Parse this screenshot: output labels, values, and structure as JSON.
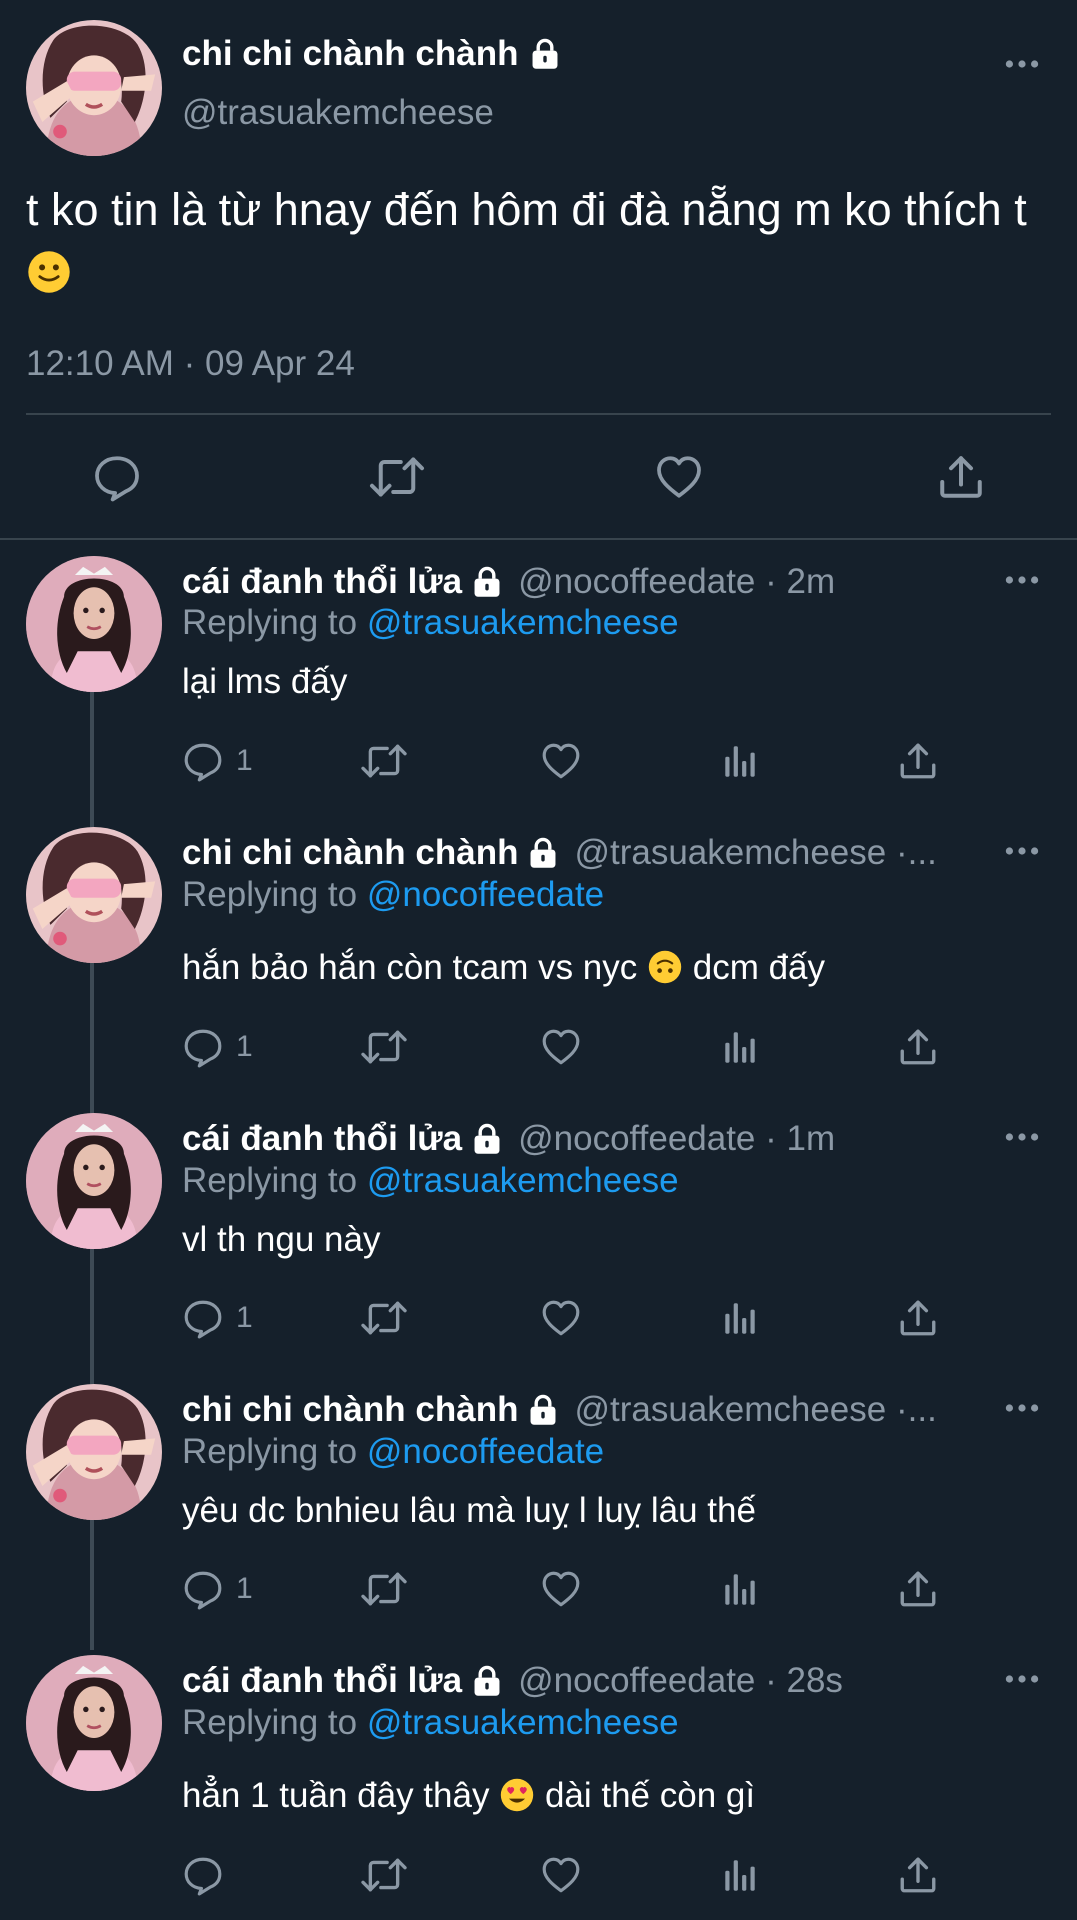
{
  "main_tweet": {
    "display_name": "chi chi chành chành",
    "handle": "@trasuakemcheese",
    "text": "t ko tin là từ hnay đến hôm đi đà nẵng m ko thích t",
    "timestamp": "12:10 AM · 09 Apr 24",
    "actions": [
      "reply-icon",
      "retweet-icon",
      "like-icon",
      "share-icon"
    ]
  },
  "replies": [
    {
      "display_name": "cái đanh thổi lửa",
      "handle_meta": "@nocoffeedate · 2m",
      "replying_label": "Replying to",
      "replying_to": "@trasuakemcheese",
      "text": "lại lms đấy",
      "reply_count": "1",
      "avatar": "girl"
    },
    {
      "display_name": "chi chi chành chành",
      "handle_meta": "@trasuakemcheese ·...",
      "replying_label": "Replying to",
      "replying_to": "@nocoffeedate",
      "text_before": "hắn bảo hắn còn tcam vs nyc",
      "text_after": "dcm đấy",
      "reply_count": "1",
      "avatar": "cartoon"
    },
    {
      "display_name": "cái đanh thổi lửa",
      "handle_meta": "@nocoffeedate · 1m",
      "replying_label": "Replying to",
      "replying_to": "@trasuakemcheese",
      "text": "vl th ngu này",
      "reply_count": "1",
      "avatar": "girl"
    },
    {
      "display_name": "chi chi chành chành",
      "handle_meta": "@trasuakemcheese ·...",
      "replying_label": "Replying to",
      "replying_to": "@nocoffeedate",
      "text": "yêu dc bnhieu lâu mà luỵ l luỵ lâu thế",
      "reply_count": "1",
      "avatar": "cartoon"
    },
    {
      "display_name": "cái đanh thổi lửa",
      "handle_meta": "@nocoffeedate · 28s",
      "replying_label": "Replying to",
      "replying_to": "@trasuakemcheese",
      "text_before": "hẳn 1 tuần đây thây",
      "text_after": "dài thế còn gì",
      "reply_count": "",
      "avatar": "girl"
    }
  ],
  "colors": {
    "background": "#15202b",
    "muted": "#8b98a5",
    "link": "#1d9bf0",
    "divider": "#38444d"
  }
}
